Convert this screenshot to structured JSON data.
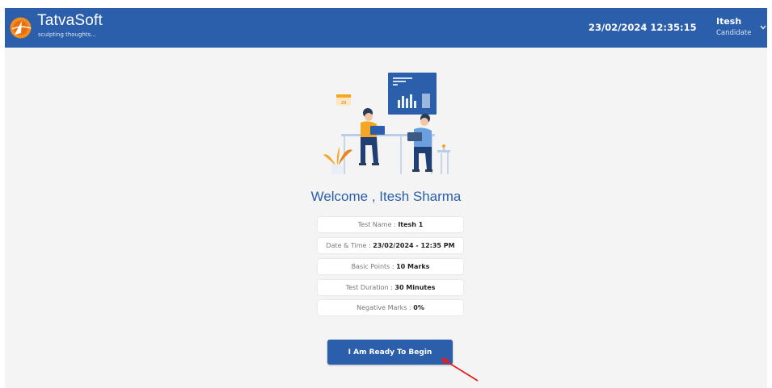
{
  "header": {
    "brand": "TatvaSoft",
    "tagline": "sculpting thoughts...",
    "datetime": "23/02/2024 12:35:15",
    "user_name": "Itesh",
    "user_role": "Candidate"
  },
  "welcome": {
    "title": "Welcome , Itesh Sharma"
  },
  "test_info": [
    {
      "label": "Test Name : ",
      "value": "Itesh 1"
    },
    {
      "label": "Date & Time : ",
      "value": "23/02/2024 - 12:35 PM"
    },
    {
      "label": "Basic Points : ",
      "value": "10 Marks"
    },
    {
      "label": "Test Duration : ",
      "value": "30 Minutes"
    },
    {
      "label": "Negative Marks : ",
      "value": "0%"
    }
  ],
  "begin_button": "I Am Ready To Begin",
  "illustration": {
    "calendar_day": "29"
  },
  "colors": {
    "brand_blue": "#2b5eab",
    "arrow_red": "#e02020",
    "accent_orange": "#f5a623"
  }
}
